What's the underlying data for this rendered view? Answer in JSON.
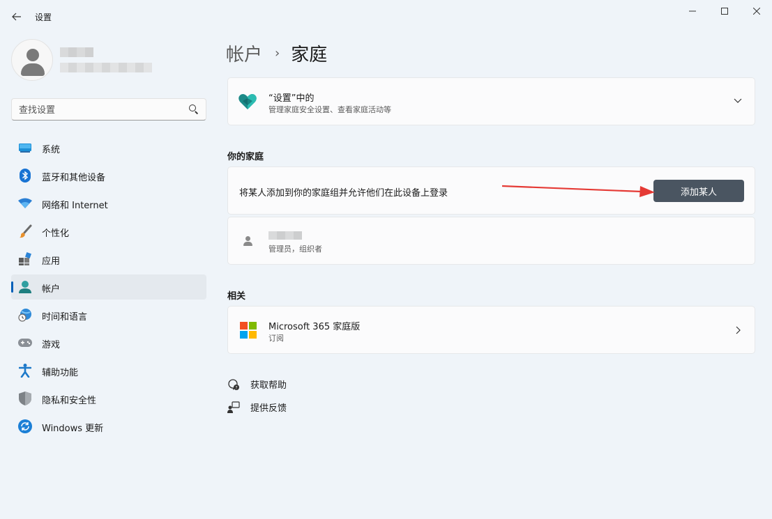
{
  "window": {
    "title": "设置",
    "back_icon": "arrow-left-icon",
    "controls": [
      "minimize-icon",
      "maximize-icon",
      "close-icon"
    ]
  },
  "sidebar": {
    "search": {
      "placeholder": "查找设置"
    },
    "items": [
      {
        "label": "系统",
        "icon": "system-display-icon"
      },
      {
        "label": "蓝牙和其他设备",
        "icon": "bluetooth-icon"
      },
      {
        "label": "网络和 Internet",
        "icon": "wifi-icon"
      },
      {
        "label": "个性化",
        "icon": "paintbrush-icon"
      },
      {
        "label": "应用",
        "icon": "apps-icon"
      },
      {
        "label": "帐户",
        "icon": "account-icon",
        "active": true
      },
      {
        "label": "时间和语言",
        "icon": "globe-clock-icon"
      },
      {
        "label": "游戏",
        "icon": "gamepad-icon"
      },
      {
        "label": "辅助功能",
        "icon": "accessibility-icon"
      },
      {
        "label": "隐私和安全性",
        "icon": "shield-icon"
      },
      {
        "label": "Windows 更新",
        "icon": "update-icon"
      }
    ]
  },
  "breadcrumb": {
    "parent": "帐户",
    "separator": "›",
    "current": "家庭"
  },
  "family_app_card": {
    "title": "“设置”中的",
    "subtitle": "管理家庭安全设置、查看家庭活动等",
    "icon": "family-heart-icon"
  },
  "your_family": {
    "heading": "你的家庭",
    "add_text": "将某人添加到你的家庭组并允许他们在此设备上登录",
    "add_button": "添加某人",
    "member": {
      "role": "管理员，组织者"
    }
  },
  "related": {
    "heading": "相关",
    "ms365": {
      "title": "Microsoft 365 家庭版",
      "subtitle": "订阅",
      "icon": "microsoft-logo-icon"
    }
  },
  "footer_links": [
    {
      "label": "获取帮助",
      "icon": "help-chat-icon"
    },
    {
      "label": "提供反馈",
      "icon": "feedback-icon"
    }
  ],
  "colors": {
    "accent": "#005fb8",
    "background": "#eff4f9",
    "button": "#4a5561",
    "annotation_arrow": "#e53a35"
  }
}
